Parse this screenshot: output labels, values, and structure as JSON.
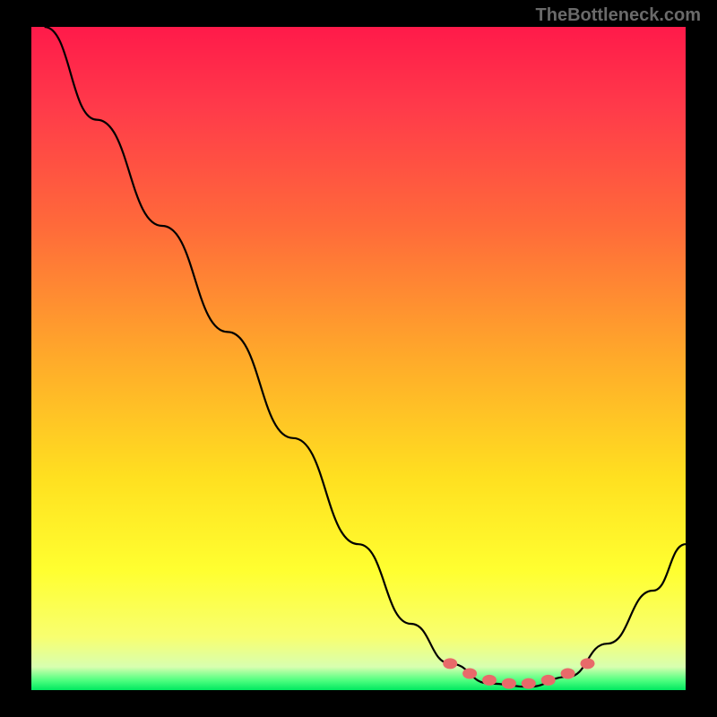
{
  "watermark": "TheBottleneck.com",
  "chart_data": {
    "type": "line",
    "title": "",
    "xlabel": "",
    "ylabel": "",
    "x_range": [
      0,
      100
    ],
    "y_range": [
      0,
      100
    ],
    "series": [
      {
        "name": "bottleneck-curve",
        "points": [
          {
            "x": 2,
            "y": 100
          },
          {
            "x": 10,
            "y": 86
          },
          {
            "x": 20,
            "y": 70
          },
          {
            "x": 30,
            "y": 54
          },
          {
            "x": 40,
            "y": 38
          },
          {
            "x": 50,
            "y": 22
          },
          {
            "x": 58,
            "y": 10
          },
          {
            "x": 64,
            "y": 4
          },
          {
            "x": 70,
            "y": 1
          },
          {
            "x": 76,
            "y": 0.5
          },
          {
            "x": 82,
            "y": 2
          },
          {
            "x": 88,
            "y": 7
          },
          {
            "x": 95,
            "y": 15
          },
          {
            "x": 100,
            "y": 22
          }
        ]
      },
      {
        "name": "marker-dots",
        "points": [
          {
            "x": 64,
            "y": 4
          },
          {
            "x": 67,
            "y": 2.5
          },
          {
            "x": 70,
            "y": 1.5
          },
          {
            "x": 73,
            "y": 1
          },
          {
            "x": 76,
            "y": 1
          },
          {
            "x": 79,
            "y": 1.5
          },
          {
            "x": 82,
            "y": 2.5
          },
          {
            "x": 85,
            "y": 4
          }
        ]
      }
    ],
    "gradient_stops": [
      {
        "offset": 0,
        "color": "#ff1a4a"
      },
      {
        "offset": 0.12,
        "color": "#ff3a4a"
      },
      {
        "offset": 0.3,
        "color": "#ff6a3a"
      },
      {
        "offset": 0.5,
        "color": "#ffaa2a"
      },
      {
        "offset": 0.68,
        "color": "#ffe020"
      },
      {
        "offset": 0.82,
        "color": "#ffff30"
      },
      {
        "offset": 0.92,
        "color": "#f8ff70"
      },
      {
        "offset": 0.965,
        "color": "#d8ffb0"
      },
      {
        "offset": 0.985,
        "color": "#50ff80"
      },
      {
        "offset": 1.0,
        "color": "#00e860"
      }
    ],
    "marker_color": "#e86a6a"
  }
}
